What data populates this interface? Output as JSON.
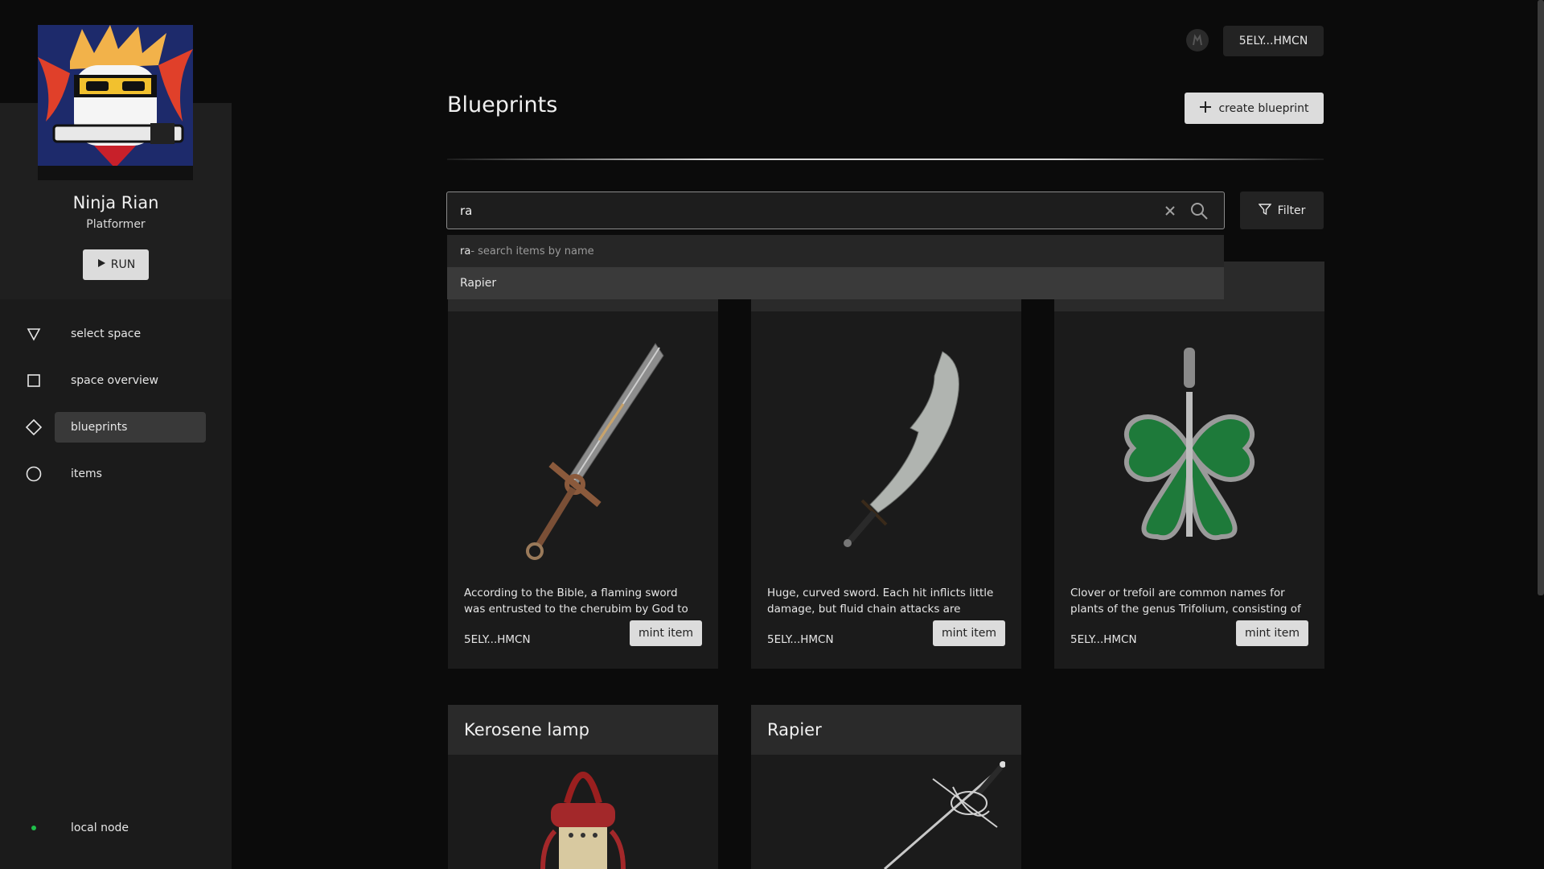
{
  "sidebar": {
    "space_name": "Ninja Rian",
    "space_type": "Platformer",
    "run_label": "RUN",
    "nav": [
      {
        "label": "select space",
        "icon": "triangle-down-icon"
      },
      {
        "label": "space overview",
        "icon": "square-icon"
      },
      {
        "label": "blueprints",
        "icon": "diamond-icon",
        "active": true
      },
      {
        "label": "items",
        "icon": "circle-icon"
      }
    ],
    "node_label": "local node",
    "node_status_color": "#1fbf4a"
  },
  "header": {
    "account": "5ELY...HMCN"
  },
  "page": {
    "title": "Blueprints",
    "create_label": "create blueprint"
  },
  "search": {
    "value": "ra",
    "filter_label": "Filter",
    "hint_query": "ra",
    "hint_text": " - search items by name",
    "suggestion": "Rapier"
  },
  "cards": [
    {
      "title": "",
      "description": "According to the Bible, a flaming sword was entrusted to the cherubim by God to guard…",
      "owner": "5ELY...HMCN",
      "button": "mint item"
    },
    {
      "title": "",
      "description": "Huge, curved sword. Each hit inflicts little damage, but fluid chain attacks are deadly.\"…",
      "owner": "5ELY...HMCN",
      "button": "mint item"
    },
    {
      "title": "",
      "description": "Clover or trefoil are common names for plants of the genus Trifolium, consisting of about…",
      "owner": "5ELY...HMCN",
      "button": "mint item"
    },
    {
      "title": "Kerosene lamp"
    },
    {
      "title": "Rapier"
    }
  ]
}
